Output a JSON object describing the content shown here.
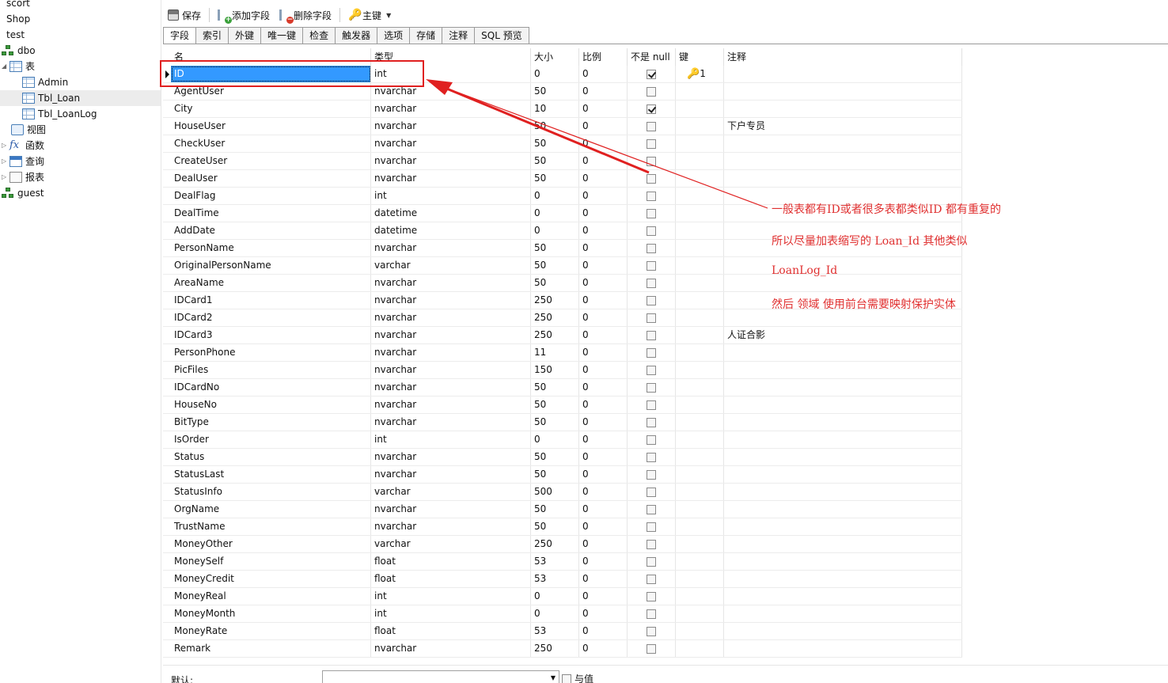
{
  "sidebar": {
    "items": [
      {
        "label": "scort",
        "icon": "none"
      },
      {
        "label": "Shop",
        "icon": "none"
      },
      {
        "label": "test",
        "icon": "none"
      },
      {
        "label": "dbo",
        "icon": "schema-icon"
      },
      {
        "label": "表",
        "icon": "tables-icon"
      },
      {
        "label": "Admin",
        "icon": "table-icon"
      },
      {
        "label": "Tbl_Loan",
        "icon": "table-icon",
        "selected": true
      },
      {
        "label": "Tbl_LoanLog",
        "icon": "table-icon"
      },
      {
        "label": "视图",
        "icon": "view-icon"
      },
      {
        "label": "函数",
        "icon": "function-icon"
      },
      {
        "label": "查询",
        "icon": "query-icon"
      },
      {
        "label": "报表",
        "icon": "report-icon"
      },
      {
        "label": "guest",
        "icon": "schema-icon"
      }
    ]
  },
  "toolbar": {
    "save": "保存",
    "add_field": "添加字段",
    "delete_field": "删除字段",
    "primary_key": "主键"
  },
  "tabs": [
    "字段",
    "索引",
    "外键",
    "唯一键",
    "检查",
    "触发器",
    "选项",
    "存储",
    "注释",
    "SQL 预览"
  ],
  "active_tab": "字段",
  "columns": {
    "name": "名",
    "type": "类型",
    "size": "大小",
    "scale": "比例",
    "notnull": "不是 null",
    "key": "键",
    "note": "注释"
  },
  "rows": [
    {
      "name": "ID",
      "type": "int",
      "size": "0",
      "scale": "0",
      "notnull": true,
      "key": "1",
      "note": ""
    },
    {
      "name": "AgentUser",
      "type": "nvarchar",
      "size": "50",
      "scale": "0",
      "notnull": false,
      "key": "",
      "note": ""
    },
    {
      "name": "City",
      "type": "nvarchar",
      "size": "10",
      "scale": "0",
      "notnull": true,
      "key": "",
      "note": ""
    },
    {
      "name": "HouseUser",
      "type": "nvarchar",
      "size": "50",
      "scale": "0",
      "notnull": false,
      "key": "",
      "note": "下户专员"
    },
    {
      "name": "CheckUser",
      "type": "nvarchar",
      "size": "50",
      "scale": "0",
      "notnull": false,
      "key": "",
      "note": ""
    },
    {
      "name": "CreateUser",
      "type": "nvarchar",
      "size": "50",
      "scale": "0",
      "notnull": false,
      "key": "",
      "note": ""
    },
    {
      "name": "DealUser",
      "type": "nvarchar",
      "size": "50",
      "scale": "0",
      "notnull": false,
      "key": "",
      "note": ""
    },
    {
      "name": "DealFlag",
      "type": "int",
      "size": "0",
      "scale": "0",
      "notnull": false,
      "key": "",
      "note": ""
    },
    {
      "name": "DealTime",
      "type": "datetime",
      "size": "0",
      "scale": "0",
      "notnull": false,
      "key": "",
      "note": ""
    },
    {
      "name": "AddDate",
      "type": "datetime",
      "size": "0",
      "scale": "0",
      "notnull": false,
      "key": "",
      "note": ""
    },
    {
      "name": "PersonName",
      "type": "nvarchar",
      "size": "50",
      "scale": "0",
      "notnull": false,
      "key": "",
      "note": ""
    },
    {
      "name": "OriginalPersonName",
      "type": "varchar",
      "size": "50",
      "scale": "0",
      "notnull": false,
      "key": "",
      "note": ""
    },
    {
      "name": "AreaName",
      "type": "nvarchar",
      "size": "50",
      "scale": "0",
      "notnull": false,
      "key": "",
      "note": ""
    },
    {
      "name": "IDCard1",
      "type": "nvarchar",
      "size": "250",
      "scale": "0",
      "notnull": false,
      "key": "",
      "note": ""
    },
    {
      "name": "IDCard2",
      "type": "nvarchar",
      "size": "250",
      "scale": "0",
      "notnull": false,
      "key": "",
      "note": ""
    },
    {
      "name": "IDCard3",
      "type": "nvarchar",
      "size": "250",
      "scale": "0",
      "notnull": false,
      "key": "",
      "note": "人证合影"
    },
    {
      "name": "PersonPhone",
      "type": "nvarchar",
      "size": "11",
      "scale": "0",
      "notnull": false,
      "key": "",
      "note": ""
    },
    {
      "name": "PicFiles",
      "type": "nvarchar",
      "size": "150",
      "scale": "0",
      "notnull": false,
      "key": "",
      "note": ""
    },
    {
      "name": "IDCardNo",
      "type": "nvarchar",
      "size": "50",
      "scale": "0",
      "notnull": false,
      "key": "",
      "note": ""
    },
    {
      "name": "HouseNo",
      "type": "nvarchar",
      "size": "50",
      "scale": "0",
      "notnull": false,
      "key": "",
      "note": ""
    },
    {
      "name": "BitType",
      "type": "nvarchar",
      "size": "50",
      "scale": "0",
      "notnull": false,
      "key": "",
      "note": ""
    },
    {
      "name": "IsOrder",
      "type": "int",
      "size": "0",
      "scale": "0",
      "notnull": false,
      "key": "",
      "note": ""
    },
    {
      "name": "Status",
      "type": "nvarchar",
      "size": "50",
      "scale": "0",
      "notnull": false,
      "key": "",
      "note": ""
    },
    {
      "name": "StatusLast",
      "type": "nvarchar",
      "size": "50",
      "scale": "0",
      "notnull": false,
      "key": "",
      "note": ""
    },
    {
      "name": "StatusInfo",
      "type": "varchar",
      "size": "500",
      "scale": "0",
      "notnull": false,
      "key": "",
      "note": ""
    },
    {
      "name": "OrgName",
      "type": "nvarchar",
      "size": "50",
      "scale": "0",
      "notnull": false,
      "key": "",
      "note": ""
    },
    {
      "name": "TrustName",
      "type": "nvarchar",
      "size": "50",
      "scale": "0",
      "notnull": false,
      "key": "",
      "note": ""
    },
    {
      "name": "MoneyOther",
      "type": "varchar",
      "size": "250",
      "scale": "0",
      "notnull": false,
      "key": "",
      "note": ""
    },
    {
      "name": "MoneySelf",
      "type": "float",
      "size": "53",
      "scale": "0",
      "notnull": false,
      "key": "",
      "note": ""
    },
    {
      "name": "MoneyCredit",
      "type": "float",
      "size": "53",
      "scale": "0",
      "notnull": false,
      "key": "",
      "note": ""
    },
    {
      "name": "MoneyReal",
      "type": "int",
      "size": "0",
      "scale": "0",
      "notnull": false,
      "key": "",
      "note": ""
    },
    {
      "name": "MoneyMonth",
      "type": "int",
      "size": "0",
      "scale": "0",
      "notnull": false,
      "key": "",
      "note": ""
    },
    {
      "name": "MoneyRate",
      "type": "float",
      "size": "53",
      "scale": "0",
      "notnull": false,
      "key": "",
      "note": ""
    },
    {
      "name": "Remark",
      "type": "nvarchar",
      "size": "250",
      "scale": "0",
      "notnull": false,
      "key": "",
      "note": ""
    }
  ],
  "annotation": {
    "line1": "一般表都有ID或者很多表都类似ID 都有重复的",
    "line2": "所以尽量加表缩写的 Loan_Id    其他类似",
    "line3": "LoanLog_Id",
    "line4": "然后 领域 使用前台需要映射保护实体"
  },
  "bottom": {
    "default_label": "默认:",
    "value_label": "与值"
  },
  "colors": {
    "accent_red": "#e02020",
    "selection_blue": "#3399ff"
  }
}
